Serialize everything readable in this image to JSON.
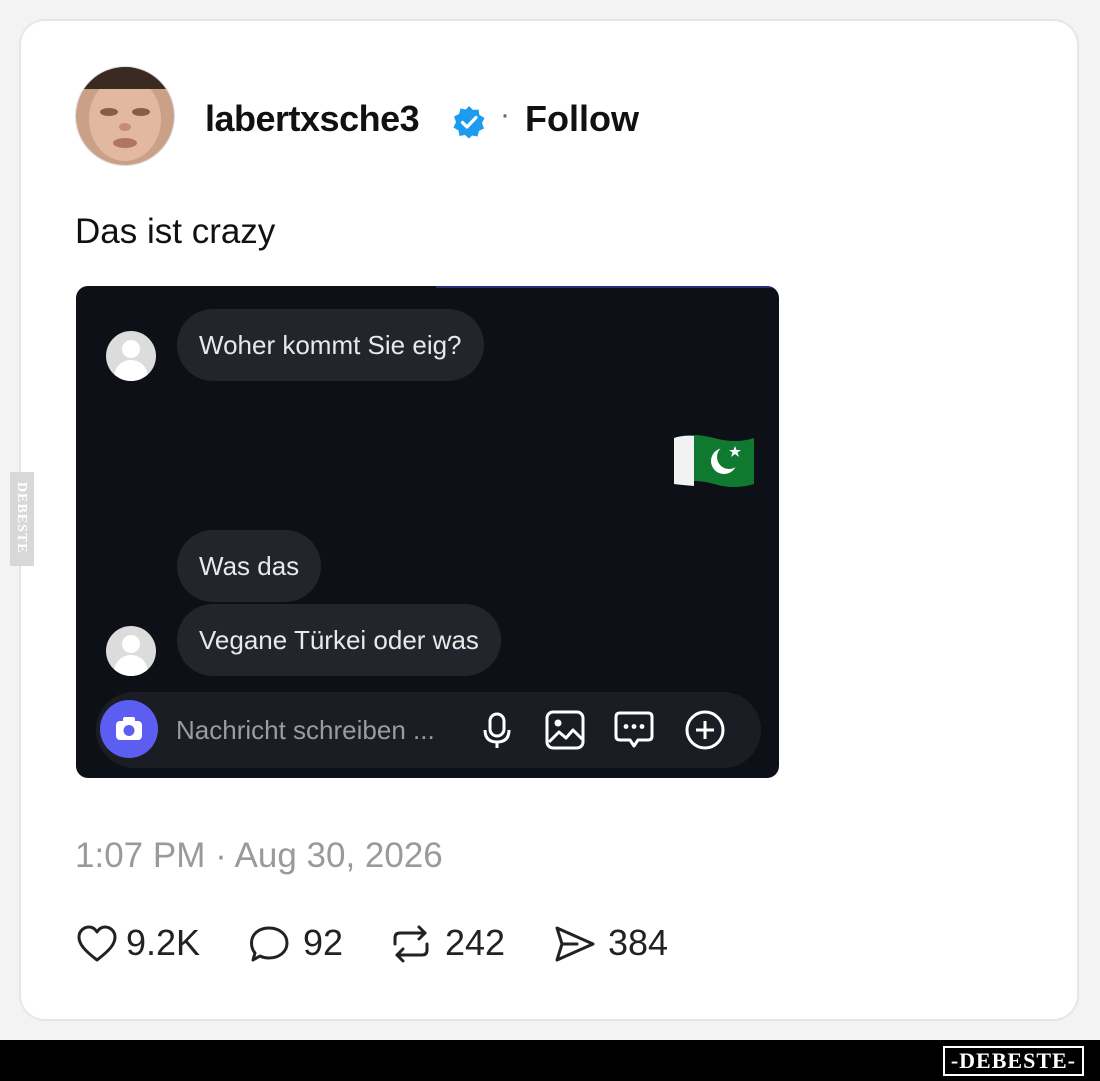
{
  "post": {
    "username": "labertxsche3",
    "separator": "·",
    "follow_label": "Follow",
    "text": "Das ist crazy",
    "timestamp": "1:07 PM · Aug 30, 2026",
    "stats": {
      "likes": "9.2K",
      "replies": "92",
      "reposts": "242",
      "shares": "384"
    }
  },
  "chat": {
    "messages": [
      "Woher kommt Sie eig?",
      "Was das",
      "Vegane Türkei oder was"
    ],
    "composer_placeholder": "Nachricht schreiben ...",
    "flag_icon": "pakistan-flag-emoji"
  },
  "watermark": {
    "bottom_logo": "-DEBESTE-",
    "side_logo": "DEBESTE"
  },
  "colors": {
    "verified": "#1d9bf0",
    "chat_bg": "#0e1017",
    "bubble_bg": "#23252d",
    "camera_button": "#5b5ef0"
  }
}
